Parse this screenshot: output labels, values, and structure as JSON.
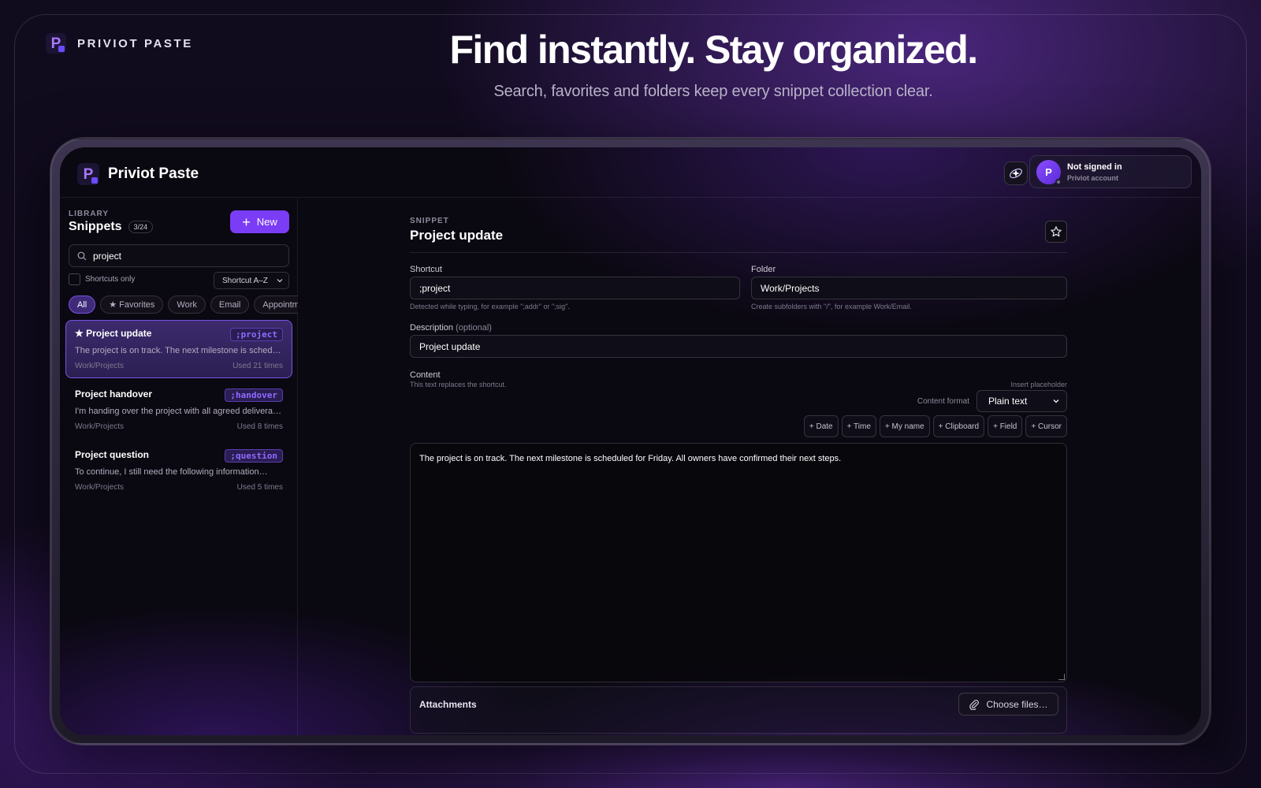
{
  "marketing": {
    "brand": "PRIVIOT PASTE",
    "headline": "Find instantly. Stay organized.",
    "subline": "Search, favorites and folders keep every snippet collection clear."
  },
  "app": {
    "title": "Priviot Paste",
    "logo_letter": "P",
    "account": {
      "avatar_letter": "P",
      "status": "Not signed in",
      "subtitle": "Priviot account"
    }
  },
  "sidebar": {
    "section_label": "LIBRARY",
    "title": "Snippets",
    "count": "3/24",
    "new_label": "New",
    "search_value": "project",
    "shortcuts_only_label": "Shortcuts only",
    "shortcuts_only_checked": false,
    "sort_value": "Shortcut A–Z",
    "filters": [
      {
        "label": "All",
        "active": true
      },
      {
        "label": "★ Favorites",
        "active": false
      },
      {
        "label": "Work",
        "active": false
      },
      {
        "label": "Email",
        "active": false
      },
      {
        "label": "Appointme",
        "active": false
      }
    ],
    "items": [
      {
        "title": "★ Project update",
        "shortcut": ";project",
        "preview": "The project is on track. The next milestone is schedul…",
        "folder": "Work/Projects",
        "usage": "Used 21 times",
        "selected": true,
        "favorite": true
      },
      {
        "title": "Project handover",
        "shortcut": ";handover",
        "preview": "I'm handing over the project with all agreed deliverabl…",
        "folder": "Work/Projects",
        "usage": "Used 8 times",
        "selected": false,
        "favorite": false
      },
      {
        "title": "Project question",
        "shortcut": ";question",
        "preview": "To continue, I still need the following information…",
        "folder": "Work/Projects",
        "usage": "Used 5 times",
        "selected": false,
        "favorite": false
      }
    ]
  },
  "editor": {
    "section_label": "SNIPPET",
    "title": "Project update",
    "shortcut_label": "Shortcut",
    "shortcut_value": ";project",
    "shortcut_hint": "Detected while typing, for example \";addr\" or \";sig\".",
    "folder_label": "Folder",
    "folder_value": "Work/Projects",
    "folder_hint": "Create subfolders with \"/\", for example Work/Email.",
    "description_label": "Description",
    "description_optional": "(optional)",
    "description_value": "Project update",
    "content_label": "Content",
    "content_hint": "This text replaces the shortcut.",
    "insert_placeholder_label": "Insert placeholder",
    "content_format_label": "Content format",
    "content_format_value": "Plain text",
    "placeholders": [
      "+ Date",
      "+ Time",
      "+ My name",
      "+ Clipboard",
      "+ Field",
      "+ Cursor"
    ],
    "content_value": "The project is on track. The next milestone is scheduled for Friday. All owners have confirmed their next steps.",
    "attachments_label": "Attachments",
    "choose_files_label": "Choose files…"
  },
  "colors": {
    "accent": "#7b3cf5",
    "shortcut_code": "#8f6bff",
    "background": "#0a0810"
  }
}
